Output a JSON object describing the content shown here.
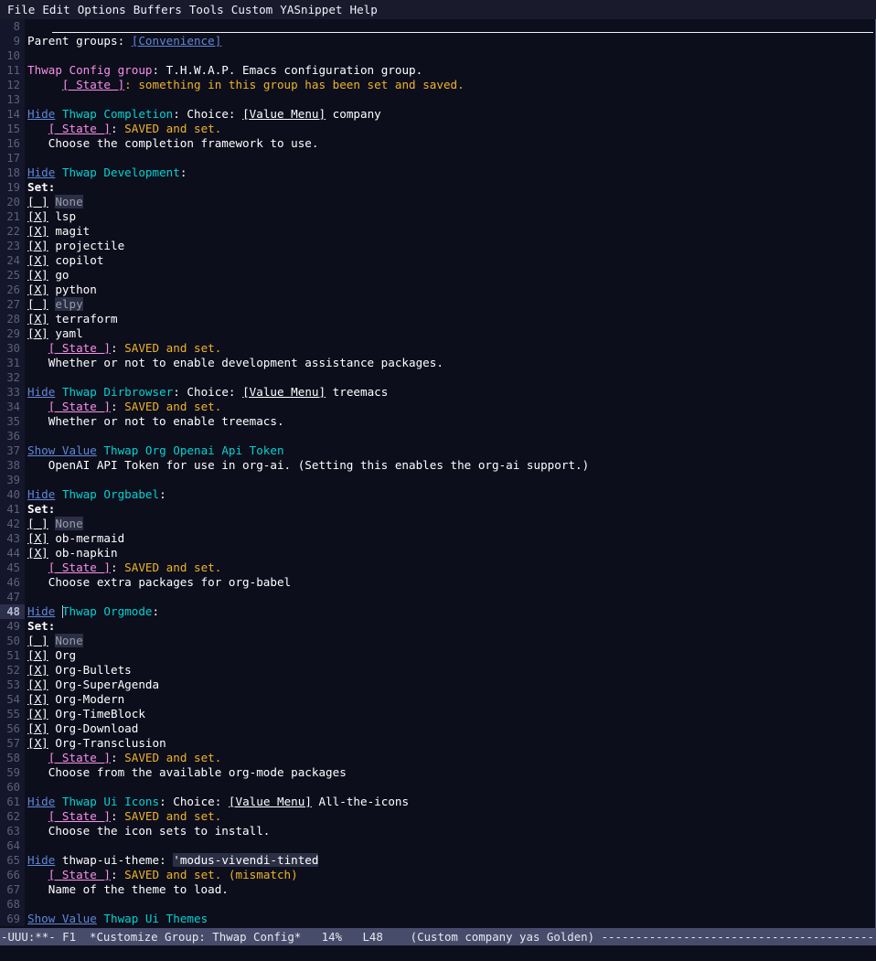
{
  "menubar": {
    "items": [
      {
        "label": "File"
      },
      {
        "label": "Edit"
      },
      {
        "label": "Options"
      },
      {
        "label": "Buffers"
      },
      {
        "label": "Tools"
      },
      {
        "label": "Custom"
      },
      {
        "label": "YASnippet"
      },
      {
        "label": "Help"
      }
    ]
  },
  "colors": {
    "background": "#0d0e1c",
    "foreground": "#ffffff",
    "teal": "#00d3d0",
    "pink": "#f78fe7",
    "orange": "#eeb329",
    "link": "#5f87d7",
    "field": "#2b2f45",
    "modeline": "#474c6b"
  },
  "buffer": {
    "first_line": 8,
    "current_line": 48,
    "lines": [
      {
        "n": 8,
        "rule": true,
        "tokens": []
      },
      {
        "n": 9,
        "tokens": [
          {
            "t": "plain",
            "s": "Parent groups: "
          },
          {
            "t": "link",
            "s": "[Convenience]",
            "name": "link-convenience"
          }
        ]
      },
      {
        "n": 10,
        "tokens": []
      },
      {
        "n": 11,
        "tokens": [
          {
            "t": "grouphead",
            "s": "Thwap Config group"
          },
          {
            "t": "plain",
            "s": ": T.H.W.A.P. Emacs configuration group."
          }
        ]
      },
      {
        "n": 12,
        "tokens": [
          {
            "t": "plain",
            "s": "     "
          },
          {
            "t": "state",
            "s": "[ State ]",
            "name": "state-button-thwap-config"
          },
          {
            "t": "orange",
            "s": ": something in this group has been set and saved."
          }
        ]
      },
      {
        "n": 13,
        "tokens": []
      },
      {
        "n": 14,
        "tokens": [
          {
            "t": "link",
            "s": "Hide",
            "name": "toggle-hide-thwap-completion"
          },
          {
            "t": "plain",
            "s": " "
          },
          {
            "t": "teal",
            "s": "Thwap Completion"
          },
          {
            "t": "plain",
            "s": ": Choice: "
          },
          {
            "t": "btn",
            "s": "[Value Menu]",
            "name": "value-menu-thwap-completion"
          },
          {
            "t": "plain",
            "s": " company"
          }
        ]
      },
      {
        "n": 15,
        "tokens": [
          {
            "t": "plain",
            "s": "   "
          },
          {
            "t": "state",
            "s": "[ State ]",
            "name": "state-button-thwap-completion"
          },
          {
            "t": "plain",
            "s": ": "
          },
          {
            "t": "orange",
            "s": "SAVED and set."
          }
        ]
      },
      {
        "n": 16,
        "tokens": [
          {
            "t": "plain",
            "s": "   Choose the completion framework to use."
          }
        ]
      },
      {
        "n": 17,
        "tokens": []
      },
      {
        "n": 18,
        "tokens": [
          {
            "t": "link",
            "s": "Hide",
            "name": "toggle-hide-thwap-development"
          },
          {
            "t": "plain",
            "s": " "
          },
          {
            "t": "teal",
            "s": "Thwap Development"
          },
          {
            "t": "plain",
            "s": ":"
          }
        ]
      },
      {
        "n": 19,
        "tokens": [
          {
            "t": "bold",
            "s": "Set:"
          }
        ]
      },
      {
        "n": 20,
        "tokens": [
          {
            "t": "cbx",
            "s": "[ ]",
            "name": "checkbox-none-development"
          },
          {
            "t": "plain",
            "s": " "
          },
          {
            "t": "field",
            "s": "None"
          }
        ]
      },
      {
        "n": 21,
        "tokens": [
          {
            "t": "cbx",
            "s": "[X]",
            "name": "checkbox-lsp"
          },
          {
            "t": "plain",
            "s": " lsp"
          }
        ]
      },
      {
        "n": 22,
        "tokens": [
          {
            "t": "cbx",
            "s": "[X]",
            "name": "checkbox-magit"
          },
          {
            "t": "plain",
            "s": " magit"
          }
        ]
      },
      {
        "n": 23,
        "tokens": [
          {
            "t": "cbx",
            "s": "[X]",
            "name": "checkbox-projectile"
          },
          {
            "t": "plain",
            "s": " projectile"
          }
        ]
      },
      {
        "n": 24,
        "tokens": [
          {
            "t": "cbx",
            "s": "[X]",
            "name": "checkbox-copilot"
          },
          {
            "t": "plain",
            "s": " copilot"
          }
        ]
      },
      {
        "n": 25,
        "tokens": [
          {
            "t": "cbx",
            "s": "[X]",
            "name": "checkbox-go"
          },
          {
            "t": "plain",
            "s": " go"
          }
        ]
      },
      {
        "n": 26,
        "tokens": [
          {
            "t": "cbx",
            "s": "[X]",
            "name": "checkbox-python"
          },
          {
            "t": "plain",
            "s": " python"
          }
        ]
      },
      {
        "n": 27,
        "tokens": [
          {
            "t": "cbx",
            "s": "[ ]",
            "name": "checkbox-elpy"
          },
          {
            "t": "plain",
            "s": " "
          },
          {
            "t": "field",
            "s": "elpy"
          }
        ]
      },
      {
        "n": 28,
        "tokens": [
          {
            "t": "cbx",
            "s": "[X]",
            "name": "checkbox-terraform"
          },
          {
            "t": "plain",
            "s": " terraform"
          }
        ]
      },
      {
        "n": 29,
        "tokens": [
          {
            "t": "cbx",
            "s": "[X]",
            "name": "checkbox-yaml"
          },
          {
            "t": "plain",
            "s": " yaml"
          }
        ]
      },
      {
        "n": 30,
        "tokens": [
          {
            "t": "plain",
            "s": "   "
          },
          {
            "t": "state",
            "s": "[ State ]",
            "name": "state-button-thwap-development"
          },
          {
            "t": "plain",
            "s": ": "
          },
          {
            "t": "orange",
            "s": "SAVED and set."
          }
        ]
      },
      {
        "n": 31,
        "tokens": [
          {
            "t": "plain",
            "s": "   Whether or not to enable development assistance packages."
          }
        ]
      },
      {
        "n": 32,
        "tokens": []
      },
      {
        "n": 33,
        "tokens": [
          {
            "t": "link",
            "s": "Hide",
            "name": "toggle-hide-thwap-dirbrowser"
          },
          {
            "t": "plain",
            "s": " "
          },
          {
            "t": "teal",
            "s": "Thwap Dirbrowser"
          },
          {
            "t": "plain",
            "s": ": Choice: "
          },
          {
            "t": "btn",
            "s": "[Value Menu]",
            "name": "value-menu-thwap-dirbrowser"
          },
          {
            "t": "plain",
            "s": " treemacs"
          }
        ]
      },
      {
        "n": 34,
        "tokens": [
          {
            "t": "plain",
            "s": "   "
          },
          {
            "t": "state",
            "s": "[ State ]",
            "name": "state-button-thwap-dirbrowser"
          },
          {
            "t": "plain",
            "s": ": "
          },
          {
            "t": "orange",
            "s": "SAVED and set."
          }
        ]
      },
      {
        "n": 35,
        "tokens": [
          {
            "t": "plain",
            "s": "   Whether or not to enable treemacs."
          }
        ]
      },
      {
        "n": 36,
        "tokens": []
      },
      {
        "n": 37,
        "tokens": [
          {
            "t": "link",
            "s": "Show Value",
            "name": "toggle-show-thwap-org-openai-api-token"
          },
          {
            "t": "plain",
            "s": " "
          },
          {
            "t": "teal",
            "s": "Thwap Org Openai Api Token"
          }
        ]
      },
      {
        "n": 38,
        "tokens": [
          {
            "t": "plain",
            "s": "   OpenAI API Token for use in org-ai. (Setting this enables the org-ai support.)"
          }
        ]
      },
      {
        "n": 39,
        "tokens": []
      },
      {
        "n": 40,
        "tokens": [
          {
            "t": "link",
            "s": "Hide",
            "name": "toggle-hide-thwap-orgbabel"
          },
          {
            "t": "plain",
            "s": " "
          },
          {
            "t": "teal",
            "s": "Thwap Orgbabel"
          },
          {
            "t": "plain",
            "s": ":"
          }
        ]
      },
      {
        "n": 41,
        "tokens": [
          {
            "t": "bold",
            "s": "Set:"
          }
        ]
      },
      {
        "n": 42,
        "tokens": [
          {
            "t": "cbx",
            "s": "[ ]",
            "name": "checkbox-none-orgbabel"
          },
          {
            "t": "plain",
            "s": " "
          },
          {
            "t": "field",
            "s": "None"
          }
        ]
      },
      {
        "n": 43,
        "tokens": [
          {
            "t": "cbx",
            "s": "[X]",
            "name": "checkbox-ob-mermaid"
          },
          {
            "t": "plain",
            "s": " ob-mermaid"
          }
        ]
      },
      {
        "n": 44,
        "tokens": [
          {
            "t": "cbx",
            "s": "[X]",
            "name": "checkbox-ob-napkin"
          },
          {
            "t": "plain",
            "s": " ob-napkin"
          }
        ]
      },
      {
        "n": 45,
        "tokens": [
          {
            "t": "plain",
            "s": "   "
          },
          {
            "t": "state",
            "s": "[ State ]",
            "name": "state-button-thwap-orgbabel"
          },
          {
            "t": "plain",
            "s": ": "
          },
          {
            "t": "orange",
            "s": "SAVED and set."
          }
        ]
      },
      {
        "n": 46,
        "tokens": [
          {
            "t": "plain",
            "s": "   Choose extra packages for org-babel"
          }
        ]
      },
      {
        "n": 47,
        "tokens": []
      },
      {
        "n": 48,
        "current": true,
        "tokens": [
          {
            "t": "link",
            "s": "Hide",
            "name": "toggle-hide-thwap-orgmode"
          },
          {
            "t": "plain",
            "s": " "
          },
          {
            "t": "cursor",
            "s": ""
          },
          {
            "t": "teal",
            "s": "Thwap Orgmode"
          },
          {
            "t": "plain",
            "s": ":"
          }
        ]
      },
      {
        "n": 49,
        "tokens": [
          {
            "t": "bold",
            "s": "Set:"
          }
        ]
      },
      {
        "n": 50,
        "tokens": [
          {
            "t": "cbx",
            "s": "[ ]",
            "name": "checkbox-none-orgmode"
          },
          {
            "t": "plain",
            "s": " "
          },
          {
            "t": "field",
            "s": "None"
          }
        ]
      },
      {
        "n": 51,
        "tokens": [
          {
            "t": "cbx",
            "s": "[X]",
            "name": "checkbox-org"
          },
          {
            "t": "plain",
            "s": " Org"
          }
        ]
      },
      {
        "n": 52,
        "tokens": [
          {
            "t": "cbx",
            "s": "[X]",
            "name": "checkbox-org-bullets"
          },
          {
            "t": "plain",
            "s": " Org-Bullets"
          }
        ]
      },
      {
        "n": 53,
        "tokens": [
          {
            "t": "cbx",
            "s": "[X]",
            "name": "checkbox-org-superagenda"
          },
          {
            "t": "plain",
            "s": " Org-SuperAgenda"
          }
        ]
      },
      {
        "n": 54,
        "tokens": [
          {
            "t": "cbx",
            "s": "[X]",
            "name": "checkbox-org-modern"
          },
          {
            "t": "plain",
            "s": " Org-Modern"
          }
        ]
      },
      {
        "n": 55,
        "tokens": [
          {
            "t": "cbx",
            "s": "[X]",
            "name": "checkbox-org-timeblock"
          },
          {
            "t": "plain",
            "s": " Org-TimeBlock"
          }
        ]
      },
      {
        "n": 56,
        "tokens": [
          {
            "t": "cbx",
            "s": "[X]",
            "name": "checkbox-org-download"
          },
          {
            "t": "plain",
            "s": " Org-Download"
          }
        ]
      },
      {
        "n": 57,
        "tokens": [
          {
            "t": "cbx",
            "s": "[X]",
            "name": "checkbox-org-transclusion"
          },
          {
            "t": "plain",
            "s": " Org-Transclusion"
          }
        ]
      },
      {
        "n": 58,
        "tokens": [
          {
            "t": "plain",
            "s": "   "
          },
          {
            "t": "state",
            "s": "[ State ]",
            "name": "state-button-thwap-orgmode"
          },
          {
            "t": "plain",
            "s": ": "
          },
          {
            "t": "orange",
            "s": "SAVED and set."
          }
        ]
      },
      {
        "n": 59,
        "tokens": [
          {
            "t": "plain",
            "s": "   Choose from the available org-mode packages"
          }
        ]
      },
      {
        "n": 60,
        "tokens": []
      },
      {
        "n": 61,
        "tokens": [
          {
            "t": "link",
            "s": "Hide",
            "name": "toggle-hide-thwap-ui-icons"
          },
          {
            "t": "plain",
            "s": " "
          },
          {
            "t": "teal",
            "s": "Thwap Ui Icons"
          },
          {
            "t": "plain",
            "s": ": Choice: "
          },
          {
            "t": "btn",
            "s": "[Value Menu]",
            "name": "value-menu-thwap-ui-icons"
          },
          {
            "t": "plain",
            "s": " All-the-icons"
          }
        ]
      },
      {
        "n": 62,
        "tokens": [
          {
            "t": "plain",
            "s": "   "
          },
          {
            "t": "state",
            "s": "[ State ]",
            "name": "state-button-thwap-ui-icons"
          },
          {
            "t": "plain",
            "s": ": "
          },
          {
            "t": "orange",
            "s": "SAVED and set."
          }
        ]
      },
      {
        "n": 63,
        "tokens": [
          {
            "t": "plain",
            "s": "   Choose the icon sets to install."
          }
        ]
      },
      {
        "n": 64,
        "tokens": []
      },
      {
        "n": 65,
        "tokens": [
          {
            "t": "link",
            "s": "Hide",
            "name": "toggle-hide-thwap-ui-theme"
          },
          {
            "t": "plain",
            "s": " thwap-ui-theme: "
          },
          {
            "t": "fieldval",
            "s": "'modus-vivendi-tinted",
            "name": "value-field-thwap-ui-theme"
          }
        ]
      },
      {
        "n": 66,
        "tokens": [
          {
            "t": "plain",
            "s": "   "
          },
          {
            "t": "state",
            "s": "[ State ]",
            "name": "state-button-thwap-ui-theme"
          },
          {
            "t": "plain",
            "s": ": "
          },
          {
            "t": "orange",
            "s": "SAVED and set. (mismatch)"
          }
        ]
      },
      {
        "n": 67,
        "tokens": [
          {
            "t": "plain",
            "s": "   Name of the theme to load."
          }
        ]
      },
      {
        "n": 68,
        "tokens": []
      },
      {
        "n": 69,
        "tokens": [
          {
            "t": "link",
            "s": "Show Value",
            "name": "toggle-show-thwap-ui-themes"
          },
          {
            "t": "plain",
            "s": " "
          },
          {
            "t": "teal",
            "s": "Thwap Ui Themes"
          }
        ]
      }
    ]
  },
  "modeline": {
    "indicators": "-UUU:**-",
    "frame": "F1",
    "buffer_name": "*Customize Group: Thwap Config*",
    "position_percent": "14%",
    "line_indicator": "L48",
    "minor_modes": "(Custom company yas Golden)",
    "fill": "---------------------------------------------------------------------------------------------------------------------------------------------------------"
  }
}
